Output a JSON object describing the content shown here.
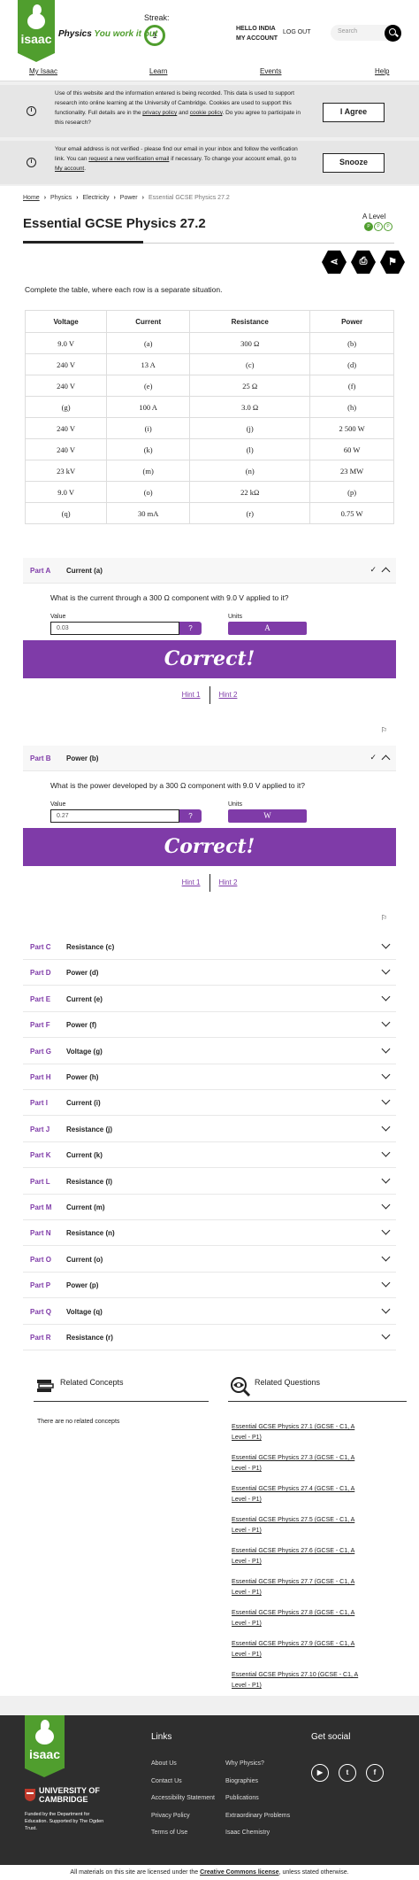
{
  "header": {
    "logo_text": "isaac",
    "tagline_a": "Physics",
    "tagline_b": "You work it out",
    "streak_label": "Streak:",
    "streak_value": "1",
    "hello": "HELLO INDIA",
    "my_account": "MY ACCOUNT",
    "logout": "LOG OUT",
    "search_placeholder": "Search"
  },
  "nav": [
    "My Isaac",
    "Learn",
    "Events",
    "Help"
  ],
  "cookie_banner": {
    "message": "Use of this website and the information entered is being recorded. This data is used to support research into online learning at the University of Cambridge. Cookies are used to support this functionality. Full details are in the",
    "privacy_link": "privacy policy",
    "and": "and",
    "cookie_link": "cookie policy",
    "tail": ". Do you agree to participate in this research?",
    "button": "I Agree"
  },
  "email_banner": {
    "message_a": "Your email address is not verified - please find our email in your inbox and follow the verification link. You can",
    "link_a": "request a new verification email",
    "message_b": "if necessary. To change your account email, go to",
    "link_b": "My account",
    "button": "Snooze"
  },
  "breadcrumb": [
    "Home",
    "Physics",
    "Electricity",
    "Power",
    "Essential GCSE Physics 27.2"
  ],
  "page_title": "Essential GCSE Physics 27.2",
  "level": {
    "label": "A Level",
    "dots": [
      "P",
      "P",
      "P"
    ]
  },
  "actions": {
    "share": "share-icon",
    "print": "print-icon",
    "report": "report-icon"
  },
  "intro": "Complete the table, where each row is a separate situation.",
  "table": {
    "headers": [
      "Voltage",
      "Current",
      "Resistance",
      "Power"
    ],
    "rows": [
      [
        "9.0 V",
        "(a)",
        "300 Ω",
        "(b)"
      ],
      [
        "240 V",
        "13 A",
        "(c)",
        "(d)"
      ],
      [
        "240 V",
        "(e)",
        "25 Ω",
        "(f)"
      ],
      [
        "(g)",
        "100 A",
        "3.0 Ω",
        "(h)"
      ],
      [
        "240 V",
        "(i)",
        "(j)",
        "2 500 W"
      ],
      [
        "240 V",
        "(k)",
        "(l)",
        "60 W"
      ],
      [
        "23 kV",
        "(m)",
        "(n)",
        "23 MW"
      ],
      [
        "9.0 V",
        "(o)",
        "22 kΩ",
        "(p)"
      ],
      [
        "(q)",
        "30 mA",
        "(r)",
        "0.75 W"
      ]
    ]
  },
  "open_parts": [
    {
      "label": "Part A",
      "title": "Current (a)",
      "tick": "✓",
      "question": "What is the current through a 300 Ω component with 9.0 V applied to it?",
      "value_label": "Value",
      "value": "0.03",
      "help": "?",
      "units_label": "Units",
      "unit": "A",
      "correct": "Correct!",
      "hint1": "Hint 1",
      "hint2": "Hint 2"
    },
    {
      "label": "Part B",
      "title": "Power (b)",
      "tick": "✓",
      "question": "What is the power developed by a 300 Ω component with 9.0 V applied to it?",
      "value_label": "Value",
      "value": "0.27",
      "help": "?",
      "units_label": "Units",
      "unit": "W",
      "correct": "Correct!",
      "hint1": "Hint 1",
      "hint2": "Hint 2"
    }
  ],
  "closed_parts": [
    {
      "label": "Part C",
      "title": "Resistance (c)"
    },
    {
      "label": "Part D",
      "title": "Power (d)"
    },
    {
      "label": "Part E",
      "title": "Current (e)"
    },
    {
      "label": "Part F",
      "title": "Power (f)"
    },
    {
      "label": "Part G",
      "title": "Voltage (g)"
    },
    {
      "label": "Part H",
      "title": "Power (h)"
    },
    {
      "label": "Part I",
      "title": "Current (i)"
    },
    {
      "label": "Part J",
      "title": "Resistance (j)"
    },
    {
      "label": "Part K",
      "title": "Current (k)"
    },
    {
      "label": "Part L",
      "title": "Resistance (l)"
    },
    {
      "label": "Part M",
      "title": "Current (m)"
    },
    {
      "label": "Part N",
      "title": "Resistance (n)"
    },
    {
      "label": "Part O",
      "title": "Current (o)"
    },
    {
      "label": "Part P",
      "title": "Power (p)"
    },
    {
      "label": "Part Q",
      "title": "Voltage (q)"
    },
    {
      "label": "Part R",
      "title": "Resistance (r)"
    }
  ],
  "related_concepts": {
    "title": "Related Concepts",
    "empty": "There are no related concepts"
  },
  "related_questions": {
    "title": "Related Questions",
    "items": [
      "Essential GCSE Physics 27.1 (GCSE - C1, A Level - P1)",
      "Essential GCSE Physics 27.3 (GCSE - C1, A Level - P1)",
      "Essential GCSE Physics 27.4 (GCSE - C1, A Level - P1)",
      "Essential GCSE Physics 27.5 (GCSE - C1, A Level - P1)",
      "Essential GCSE Physics 27.6 (GCSE - C1, A Level - P1)",
      "Essential GCSE Physics 27.7 (GCSE - C1, A Level - P1)",
      "Essential GCSE Physics 27.8 (GCSE - C1, A Level - P1)",
      "Essential GCSE Physics 27.9 (GCSE - C1, A Level - P1)",
      "Essential GCSE Physics 27.10 (GCSE - C1, A Level - P1)"
    ]
  },
  "footer": {
    "logo_text": "isaac",
    "university": "UNIVERSITY OF CAMBRIDGE",
    "funded": "Funded by the Department for Education. Supported by The Ogden Trust.",
    "links_title": "Links",
    "links_col1": [
      "About Us",
      "Contact Us",
      "Accessibility Statement",
      "Privacy Policy",
      "Terms of Use"
    ],
    "links_col2": [
      "Why Physics?",
      "Biographies",
      "Publications",
      "Extraordinary Problems",
      "Isaac Chemistry"
    ],
    "social_title": "Get social",
    "social": [
      "youtube-icon",
      "twitter-icon",
      "facebook-icon"
    ]
  },
  "copyright": {
    "a": "All materials on this site are licensed under the",
    "link": "Creative Commons license",
    "b": ", unless stated otherwise."
  },
  "colors": {
    "brand_green": "#509e2e",
    "accent_purple": "#7f3ba8",
    "footer_bg": "#2e2e2e"
  }
}
